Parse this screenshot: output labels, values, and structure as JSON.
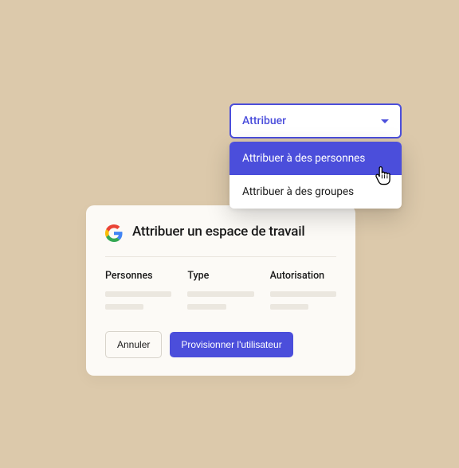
{
  "card": {
    "title": "Attribuer un espace de travail",
    "columns": {
      "col1": "Personnes",
      "col2": "Type",
      "col3": "Autorisation"
    },
    "actions": {
      "cancel": "Annuler",
      "provision": "Provisionner l'utilisateur"
    }
  },
  "dropdown": {
    "trigger": "Attribuer",
    "option1": "Attribuer à des personnes",
    "option2": "Attribuer à des groupes"
  }
}
